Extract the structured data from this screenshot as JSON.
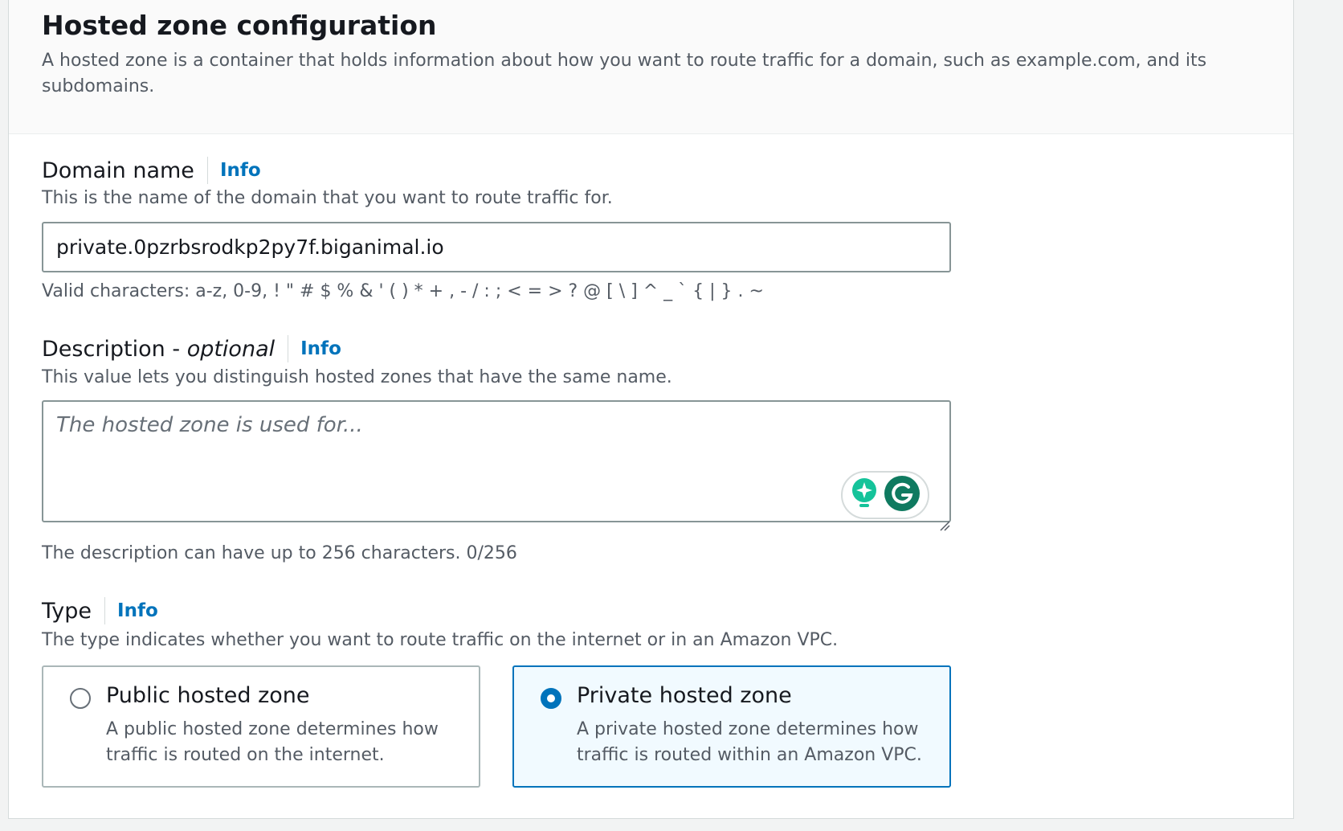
{
  "header": {
    "title": "Hosted zone configuration",
    "description": "A hosted zone is a container that holds information about how you want to route traffic for a domain, such as example.com, and its subdomains."
  },
  "domain_name": {
    "label": "Domain name",
    "info": "Info",
    "hint": "This is the name of the domain that you want to route traffic for.",
    "value": "private.0pzrbsrodkp2py7f.biganimal.io",
    "constraint": "Valid characters: a-z, 0-9, ! \" # $ % & ' ( ) * + , - / : ; < = > ? @ [ \\ ] ^ _ ` { | } . ~"
  },
  "description_field": {
    "label": "Description - ",
    "label_optional": "optional",
    "info": "Info",
    "hint": "This value lets you distinguish hosted zones that have the same name.",
    "placeholder": "The hosted zone is used for...",
    "constraint": "The description can have up to 256 characters. 0/256"
  },
  "type": {
    "label": "Type",
    "info": "Info",
    "hint": "The type indicates whether you want to route traffic on the internet or in an Amazon VPC.",
    "options": [
      {
        "title": "Public hosted zone",
        "description": "A public hosted zone determines how traffic is routed on the internet.",
        "selected": false
      },
      {
        "title": "Private hosted zone",
        "description": "A private hosted zone determines how traffic is routed within an Amazon VPC.",
        "selected": true
      }
    ]
  },
  "colors": {
    "accent": "#0073bb",
    "grammarly": "#15c39a",
    "grammarly_dark": "#0f7a60"
  },
  "icons": [
    "grammarly-suggestion-icon",
    "grammarly-g-icon",
    "resize-grip-icon"
  ]
}
